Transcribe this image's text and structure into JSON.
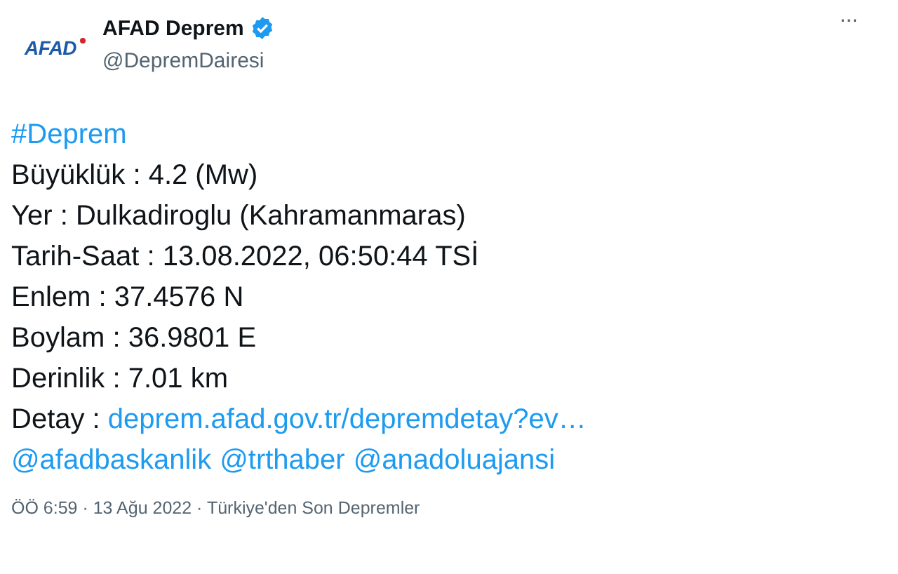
{
  "author": {
    "logo_text": "AFAD",
    "name": "AFAD Deprem",
    "verified": true,
    "handle": "@DepremDairesi"
  },
  "more_menu": "···",
  "hashtag": "#Deprem",
  "lines": [
    "Büyüklük : 4.2 (Mw)",
    "Yer : Dulkadiroglu (Kahramanmaras)",
    "Tarih-Saat : 13.08.2022, 06:50:44 TSİ",
    "Enlem : 37.4576 N",
    "Boylam : 36.9801 E",
    "Derinlik : 7.01 km"
  ],
  "detail": {
    "label": "Detay : ",
    "link": "deprem.afad.gov.tr/depremdetay?ev…"
  },
  "mentions": [
    "@afadbaskanlik",
    "@trthaber",
    "@anadoluajansi"
  ],
  "meta": "ÖÖ 6:59 · 13 Ağu 2022 · Türkiye'den Son Depremler"
}
